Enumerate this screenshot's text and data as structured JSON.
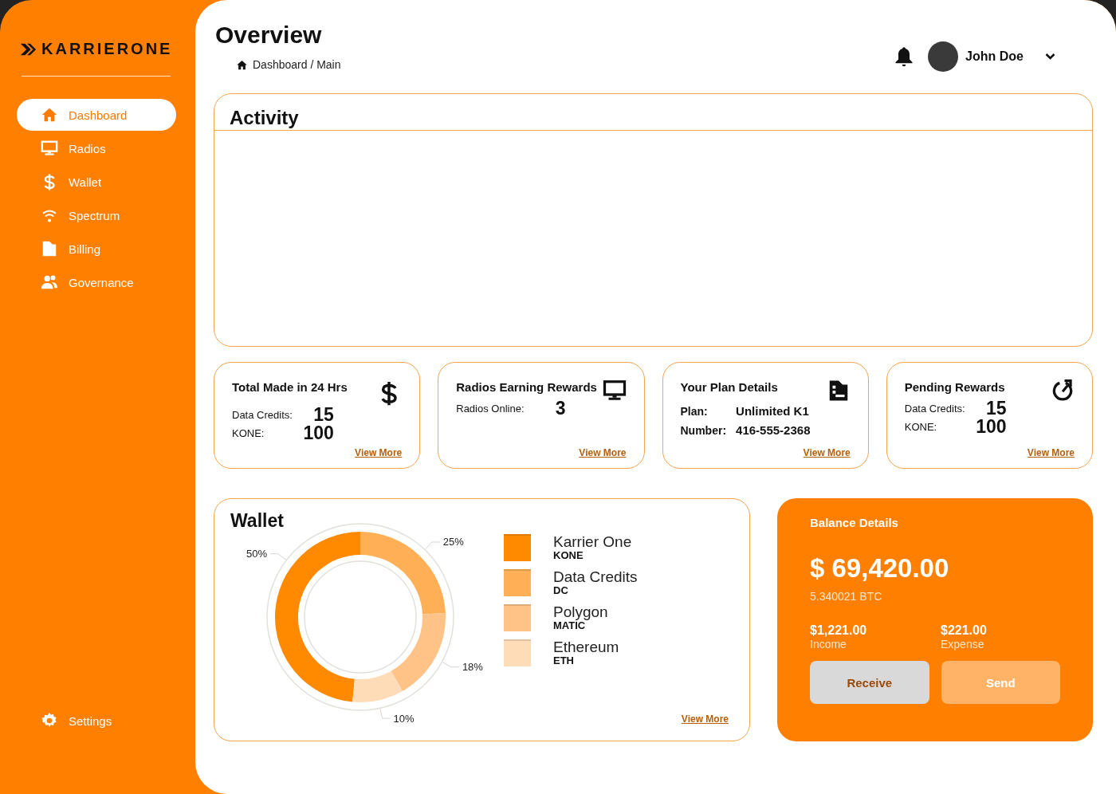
{
  "sidebar": {
    "logo": "KARRIERONE",
    "items": [
      {
        "label": "Dashboard",
        "selected": true
      },
      {
        "label": "Radios",
        "selected": false
      },
      {
        "label": "Wallet",
        "selected": false
      },
      {
        "label": "Spectrum",
        "selected": false
      },
      {
        "label": "Billing",
        "selected": false
      },
      {
        "label": "Governance",
        "selected": false
      }
    ],
    "settings": "Settings"
  },
  "header": {
    "title": "Overview",
    "breadcrumb": "Dashboard / Main",
    "user": "John Doe"
  },
  "activity": {
    "title": "Activity"
  },
  "stat_cards": [
    {
      "kind": "figures",
      "title": "Total Made in 24 Hrs",
      "rows": [
        {
          "label": "Data Credits:",
          "value": "15"
        },
        {
          "label": "KONE:",
          "value": "100"
        }
      ],
      "link": "View More"
    },
    {
      "kind": "figures",
      "title": "Radios Earning Rewards",
      "rows": [
        {
          "label": "Radios Online:",
          "value": "3"
        }
      ],
      "link": "View More"
    },
    {
      "kind": "details",
      "title": "Your Plan Details",
      "rows": [
        {
          "label": "Plan:",
          "value": "Unlimited K1"
        },
        {
          "label": "Number:",
          "value": "416-555-2368"
        }
      ],
      "link": "View More"
    },
    {
      "kind": "figures",
      "title": "Pending Rewards",
      "rows": [
        {
          "label": "Data Credits:",
          "value": "15"
        },
        {
          "label": "KONE:",
          "value": "100"
        }
      ],
      "link": "View More"
    }
  ],
  "wallet": {
    "title": "Wallet",
    "chart_data": {
      "type": "donut",
      "categories": [
        "Karrier One",
        "Data Credits",
        "Polygon",
        "Ethereum"
      ],
      "values": [
        50,
        25,
        18,
        10
      ],
      "data_labels": true,
      "value_labels": [
        "50%",
        "25%",
        "18%",
        "10%"
      ]
    },
    "legend": [
      {
        "code": "KONE",
        "color": "#ff8a00"
      },
      {
        "code": "DC",
        "color": "#ffb057"
      },
      {
        "code": "MATIC",
        "color": "#ffc388"
      },
      {
        "code": "ETH",
        "color": "#ffdcb8"
      }
    ],
    "link": "View More"
  },
  "balance": {
    "title": "Balance Details",
    "amount": "$ 69,420.00",
    "btc": "5.340021 BTC",
    "stats": [
      {
        "value": "$1,221.00",
        "label": "Income"
      },
      {
        "value": "$221.00",
        "label": "Expense"
      }
    ],
    "buttons": [
      {
        "label": "Receive",
        "kind": "secondary"
      },
      {
        "label": "Send",
        "kind": "primary"
      }
    ]
  }
}
